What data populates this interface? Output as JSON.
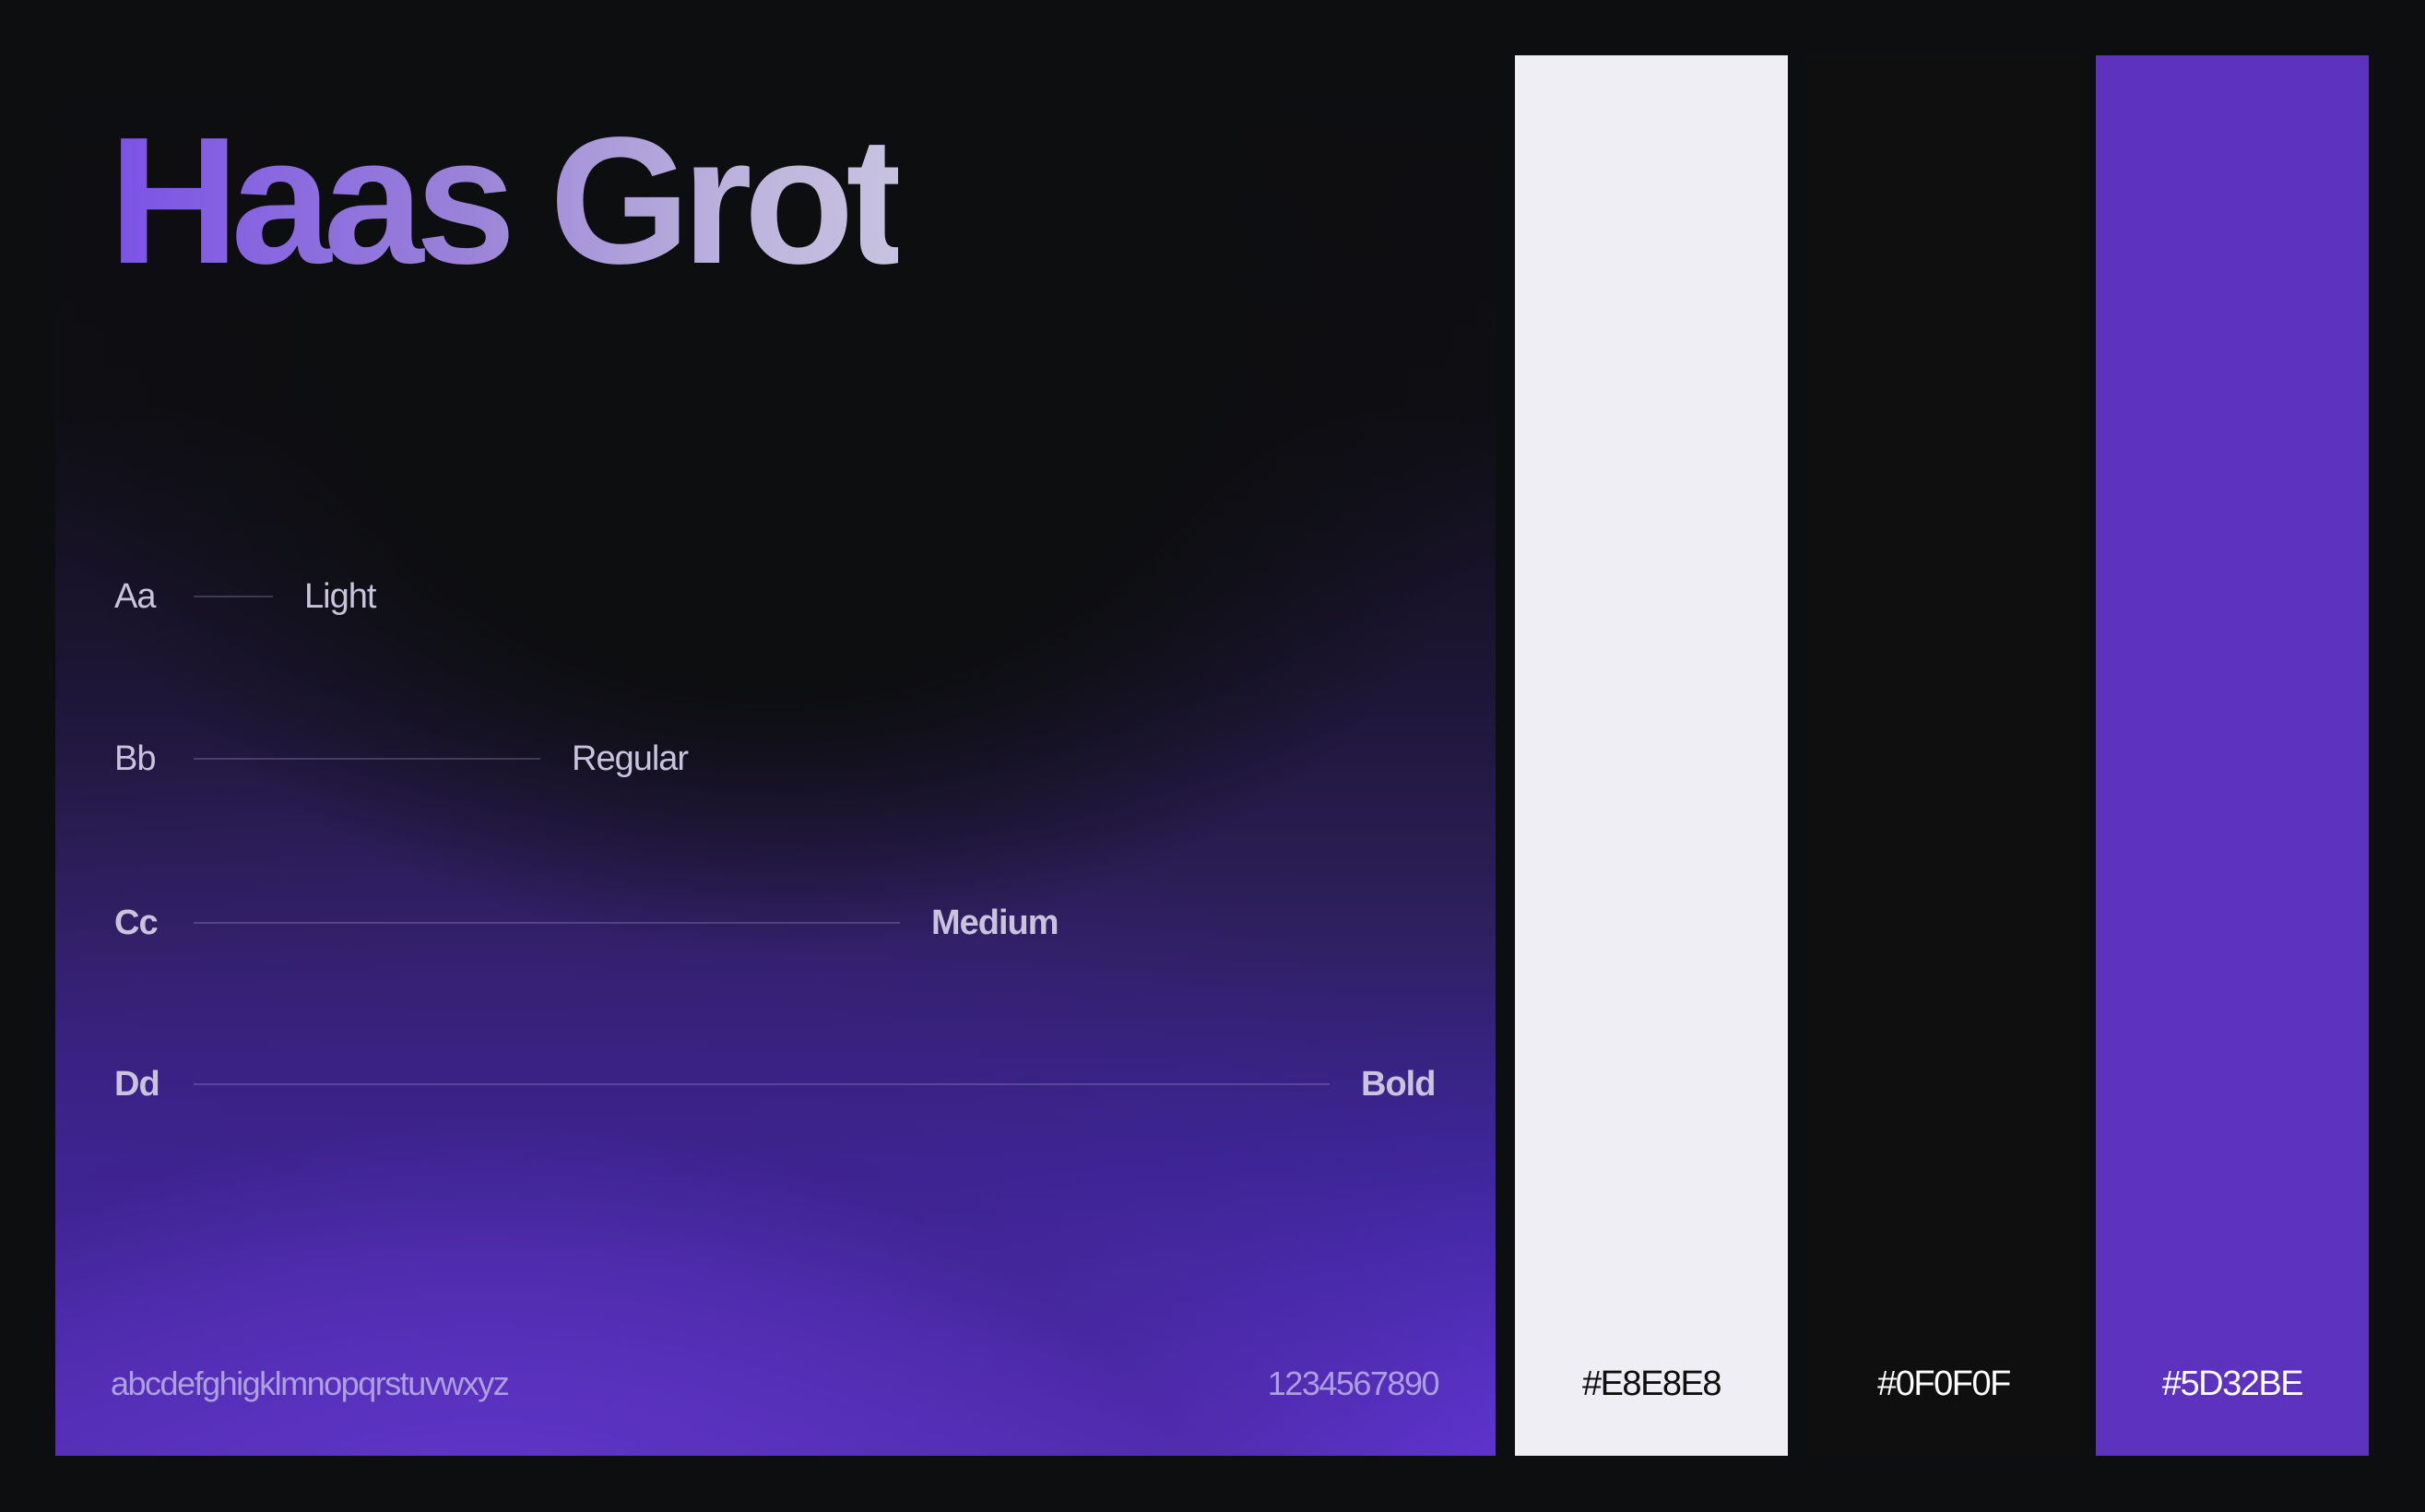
{
  "title": "Haas Grot",
  "weights": [
    {
      "sample": "Aa",
      "name": "Light"
    },
    {
      "sample": "Bb",
      "name": "Regular"
    },
    {
      "sample": "Cc",
      "name": "Medium"
    },
    {
      "sample": "Dd",
      "name": "Bold"
    }
  ],
  "alphabet": "abcdefghigklmnopqrstuvwxyz",
  "digits": "1234567890",
  "swatches": [
    {
      "label": "#E8E8E8",
      "color": "#EEEEF4",
      "text_color": "#0F0F0F"
    },
    {
      "label": "#0F0F0F",
      "color": "#0F0F0F",
      "text_color": "#FFFFFF"
    },
    {
      "label": "#5D32BE",
      "color": "#5D32BE",
      "text_color": "#FFFFFF"
    }
  ],
  "colors": {
    "background": "#0D0E10",
    "accent": "#6A3AE6",
    "text": "#C9C3DD"
  }
}
